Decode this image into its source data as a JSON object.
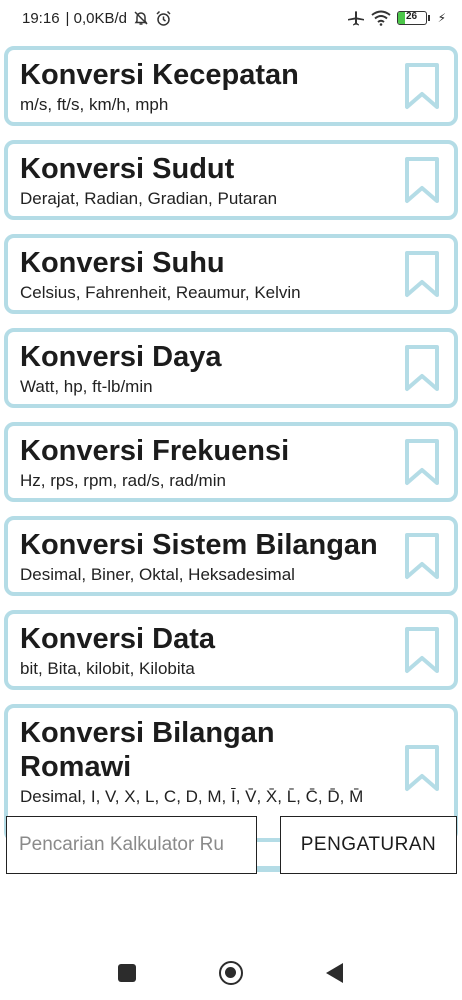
{
  "status_bar": {
    "time": "19:16",
    "network_speed": "| 0,0KB/d",
    "battery_level": "26",
    "battery_percent": 26,
    "icons": [
      "mute-bell-icon",
      "alarm-icon",
      "airplane-icon",
      "wifi-icon",
      "battery-icon",
      "charging-icon"
    ]
  },
  "cards": [
    {
      "title": "Konversi Kecepatan",
      "subtitle": "m/s, ft/s, km/h, mph"
    },
    {
      "title": "Konversi Sudut",
      "subtitle": "Derajat, Radian, Gradian, Putaran"
    },
    {
      "title": "Konversi Suhu",
      "subtitle": "Celsius, Fahrenheit, Reaumur, Kelvin"
    },
    {
      "title": "Konversi Daya",
      "subtitle": "Watt, hp, ft-lb/min"
    },
    {
      "title": "Konversi Frekuensi",
      "subtitle": "Hz, rps, rpm, rad/s, rad/min"
    },
    {
      "title": "Konversi Sistem Bilangan",
      "subtitle": "Desimal, Biner, Oktal, Heksadesimal"
    },
    {
      "title": "Konversi Data",
      "subtitle": "bit, Bita, kilobit, Kilobita"
    },
    {
      "title": "Konversi Bilangan Romawi",
      "subtitle": "Desimal, I, V, X, L, C, D, M, Ī, V̄, X̄, L̄, C̄, D̄, M̄"
    }
  ],
  "search": {
    "placeholder": "Pencarian Kalkulator Ru",
    "value": ""
  },
  "settings_label": "PENGATURAN",
  "colors": {
    "accent": "#b4dce6",
    "text": "#1c1c1c",
    "battery": "#4cc74a"
  }
}
